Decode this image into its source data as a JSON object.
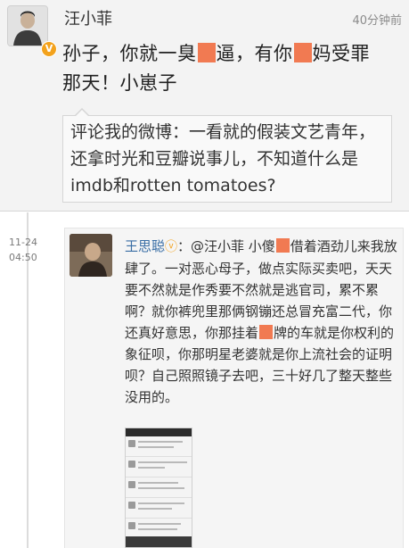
{
  "reply": {
    "name": "汪小菲",
    "time": "40分钟前",
    "badge": "V",
    "content_line1_a": "孙子，你就一臭",
    "content_line1_b": "逼，有你",
    "content_line1_c": "妈受罪",
    "content_line2": "那天！小崽子",
    "quote": "评论我的微博：一看就的假装文艺青年，还拿时光和豆瓣说事儿，不知道什么是imdb和rotten tomatoes?"
  },
  "original": {
    "date": "11-24",
    "time": "04:50",
    "name": "王思聪",
    "verified_mark": "ⓥ",
    "text_a": "：@汪小菲 小傻",
    "text_b": "借着酒劲儿来我放肆了。一对恶心母子，做点实际买卖吧，天天要不然就是作秀要不然就是逃官司，累不累啊？就你裤兜里那俩钢镚还总冒充富二代，你还真好意思，你那挂着",
    "text_c": "牌的车就是你权利的象征呗，你那明星老婆就是你上流社会的证明呗？自己照照镜子去吧，三十好几了整天整些没用的。"
  },
  "colors": {
    "mask": "#f17a52",
    "link": "#3a6ea5",
    "badge": "#f3a21c"
  }
}
